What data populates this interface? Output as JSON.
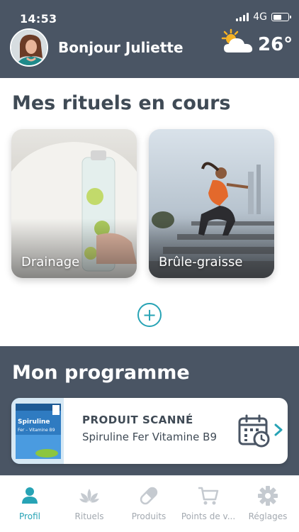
{
  "status_bar": {
    "time": "14:53",
    "network": "4G"
  },
  "header": {
    "greeting": "Bonjour Juliette",
    "temperature": "26°",
    "weather_icon": "sun-cloud-icon"
  },
  "rituels": {
    "title": "Mes rituels en cours",
    "cards": [
      {
        "label": "Drainage"
      },
      {
        "label": "Brûle-graisse"
      }
    ],
    "add_label": "+"
  },
  "programme": {
    "title": "Mon programme",
    "product_type": "PRODUIT SCANNÉ",
    "product_name": "Spiruline Fer Vitamine B9",
    "product_box_text": "Spiruline",
    "product_box_subtext": "Fer – Vitamine B9"
  },
  "tabs": [
    {
      "label": "Profil",
      "icon": "person-icon",
      "active": true
    },
    {
      "label": "Rituels",
      "icon": "lotus-icon",
      "active": false
    },
    {
      "label": "Produits",
      "icon": "pill-icon",
      "active": false
    },
    {
      "label": "Points de v...",
      "icon": "cart-icon",
      "active": false
    },
    {
      "label": "Réglages",
      "icon": "gear-icon",
      "active": false
    }
  ],
  "colors": {
    "header_bg": "#4a5564",
    "accent": "#27a3b5",
    "text": "#3f4a55",
    "tab_inactive": "#a3a9b0"
  }
}
